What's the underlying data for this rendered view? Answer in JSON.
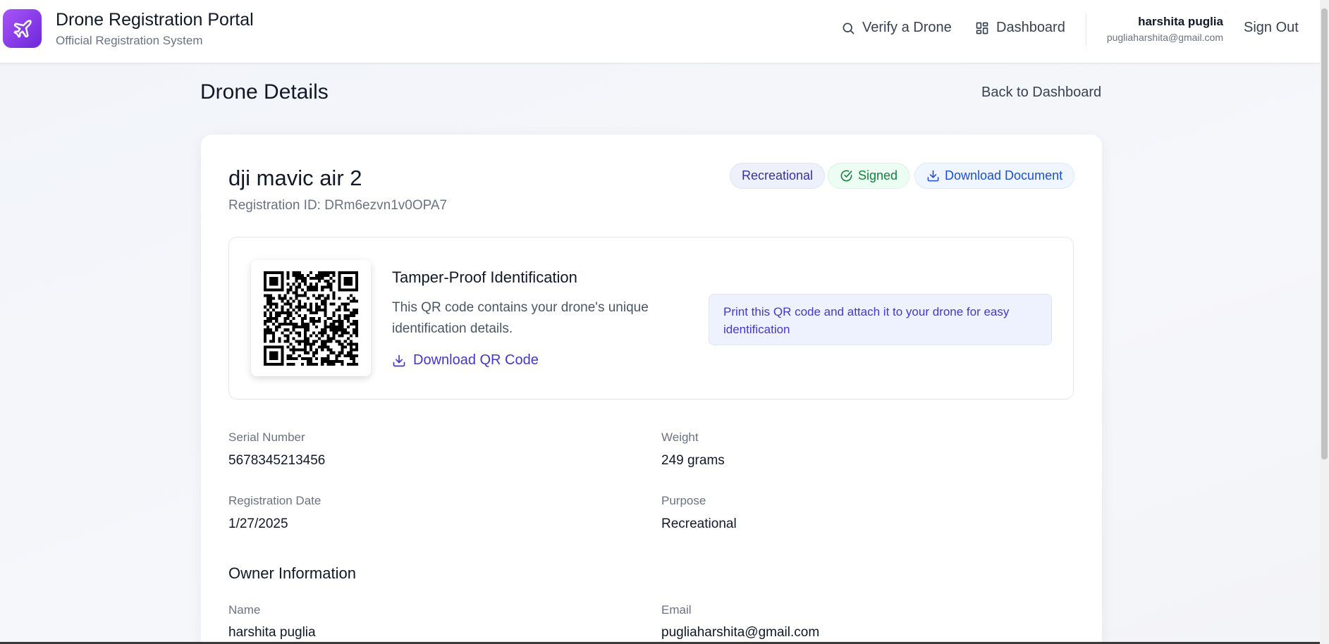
{
  "header": {
    "title": "Drone Registration Portal",
    "subtitle": "Official Registration System",
    "nav": {
      "verify_label": "Verify a Drone",
      "dashboard_label": "Dashboard"
    },
    "user": {
      "name": "harshita puglia",
      "email": "pugliaharshita@gmail.com"
    },
    "signout_label": "Sign Out"
  },
  "page": {
    "title": "Drone Details",
    "back_label": "Back to Dashboard"
  },
  "drone": {
    "name": "dji mavic air 2",
    "registration_id": "Registration ID: DRm6ezvn1v0OPA7",
    "badges": {
      "purpose": "Recreational",
      "signed": "Signed",
      "download": "Download Document"
    }
  },
  "qr": {
    "title": "Tamper-Proof Identification",
    "description": "This QR code contains your drone's unique identification details.",
    "download_label": "Download QR Code",
    "note": "Print this QR code and attach it to your drone for easy identification"
  },
  "details": {
    "serial_label": "Serial Number",
    "serial_value": "5678345213456",
    "weight_label": "Weight",
    "weight_value": "249 grams",
    "date_label": "Registration Date",
    "date_value": "1/27/2025",
    "purpose_label": "Purpose",
    "purpose_value": "Recreational"
  },
  "owner": {
    "section_title": "Owner Information",
    "name_label": "Name",
    "name_value": "harshita puglia",
    "email_label": "Email",
    "email_value": "pugliaharshita@gmail.com"
  },
  "colors": {
    "brand_gradient_start": "#a855f7",
    "brand_gradient_end": "#6d28d9",
    "accent_indigo": "#4338ca",
    "signed_green": "#15803d",
    "download_blue": "#1d4ed8"
  },
  "icons": [
    "plane-icon",
    "search-icon",
    "grid-icon",
    "check-circle-icon",
    "download-icon",
    "qr-code"
  ]
}
